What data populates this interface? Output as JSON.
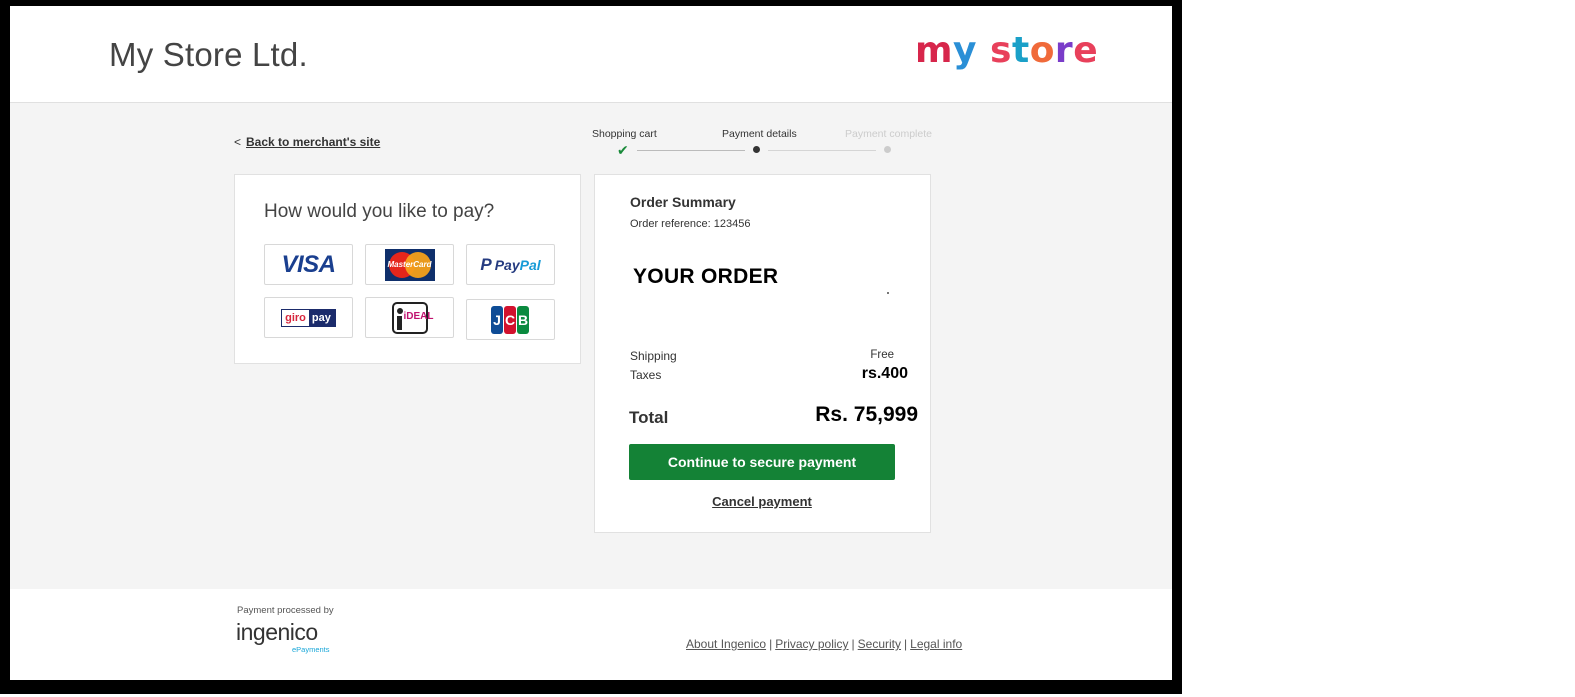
{
  "header": {
    "store_title": "My Store Ltd.",
    "logo": {
      "part1": "my",
      "part2": "store"
    }
  },
  "nav": {
    "back_arrow": "<",
    "back_label": "Back to merchant's site"
  },
  "steps": [
    {
      "label": "Shopping cart",
      "state": "done"
    },
    {
      "label": "Payment details",
      "state": "current"
    },
    {
      "label": "Payment complete",
      "state": "pending"
    }
  ],
  "payment": {
    "title": "How would you like to pay?",
    "methods": [
      {
        "name": "VISA",
        "icon": "visa-logo"
      },
      {
        "name": "MasterCard",
        "icon": "mastercard-logo"
      },
      {
        "name_p": "P",
        "name_a": "Pay",
        "name_b": "Pal",
        "icon": "paypal-logo"
      },
      {
        "name_g": "giro",
        "name_p": "pay",
        "icon": "giropay-logo"
      },
      {
        "name": "iDEAL",
        "icon": "ideal-logo"
      },
      {
        "j": "J",
        "c": "C",
        "b": "B",
        "icon": "jcb-logo"
      }
    ]
  },
  "order": {
    "title": "Order Summary",
    "reference": "Order reference: 123456",
    "your_order": "YOUR ORDER",
    "shipping_label": "Shipping",
    "shipping_value": "Free",
    "taxes_label": "Taxes",
    "taxes_value": "rs.400",
    "total_label": "Total",
    "total_value": "Rs. 75,999",
    "continue_label": "Continue to secure payment",
    "cancel_label": "Cancel payment"
  },
  "footer": {
    "processed_by": "Payment processed by",
    "brand": "ingenico",
    "brand_sub": "ePayments",
    "links": [
      "About Ingenico",
      "Privacy policy",
      "Security",
      "Legal info"
    ],
    "separator": "|"
  },
  "colors": {
    "accent_green": "#148236",
    "check_green": "#1a8a3a",
    "page_bg": "#f4f4f4"
  }
}
